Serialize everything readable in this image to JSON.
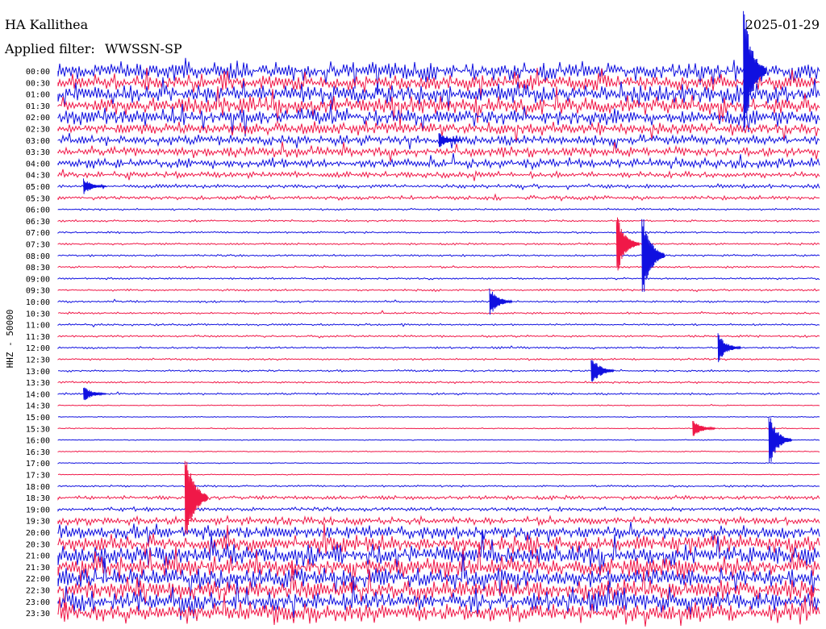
{
  "header": {
    "station": "HA Kallithea",
    "date": "2025-01-29",
    "filter_label": "Applied filter:",
    "filter_name": "WWSSN-SP"
  },
  "channel_label": "HHZ - 50000",
  "colors": {
    "even_row": "#1010e0",
    "odd_row": "#f01848"
  },
  "chart_data": {
    "type": "line",
    "title": "HA Kallithea",
    "xlabel": "",
    "ylabel": "HHZ - 50000",
    "row_labels": [
      "00:00",
      "00:30",
      "01:00",
      "01:30",
      "02:00",
      "02:30",
      "03:00",
      "03:30",
      "04:00",
      "04:30",
      "05:00",
      "05:30",
      "06:00",
      "06:30",
      "07:00",
      "07:30",
      "08:00",
      "08:30",
      "09:00",
      "09:30",
      "10:00",
      "10:30",
      "11:00",
      "11:30",
      "12:00",
      "12:30",
      "13:00",
      "13:30",
      "14:00",
      "14:30",
      "15:00",
      "15:30",
      "16:00",
      "16:30",
      "17:00",
      "17:30",
      "18:00",
      "18:30",
      "19:00",
      "19:30",
      "20:00",
      "20:30",
      "21:00",
      "21:30",
      "22:00",
      "22:30",
      "23:00",
      "23:30"
    ],
    "noise_level": [
      9,
      8,
      9,
      9,
      8,
      6,
      5,
      5,
      5,
      3,
      2,
      2,
      1,
      1,
      1,
      1,
      1,
      1,
      1,
      1,
      1,
      1,
      1,
      1,
      1,
      1,
      1,
      1,
      1,
      0.5,
      0.5,
      0.5,
      0.5,
      0.5,
      0.5,
      0.5,
      1,
      2,
      2,
      4,
      7,
      9,
      10,
      10,
      10,
      10,
      10,
      10
    ],
    "events": [
      {
        "row": 0,
        "minute": 27,
        "amp": 90
      },
      {
        "row": 16,
        "minute": 23,
        "amp": 60
      },
      {
        "row": 15,
        "minute": 22,
        "amp": 40
      },
      {
        "row": 37,
        "minute": 5,
        "amp": 70
      },
      {
        "row": 24,
        "minute": 26,
        "amp": 18
      },
      {
        "row": 26,
        "minute": 21,
        "amp": 20
      },
      {
        "row": 20,
        "minute": 17,
        "amp": 18
      },
      {
        "row": 31,
        "minute": 25,
        "amp": 12
      },
      {
        "row": 28,
        "minute": 1,
        "amp": 10
      },
      {
        "row": 10,
        "minute": 1,
        "amp": 10
      },
      {
        "row": 6,
        "minute": 15,
        "amp": 10
      },
      {
        "row": 32,
        "minute": 28,
        "amp": 35
      }
    ]
  }
}
